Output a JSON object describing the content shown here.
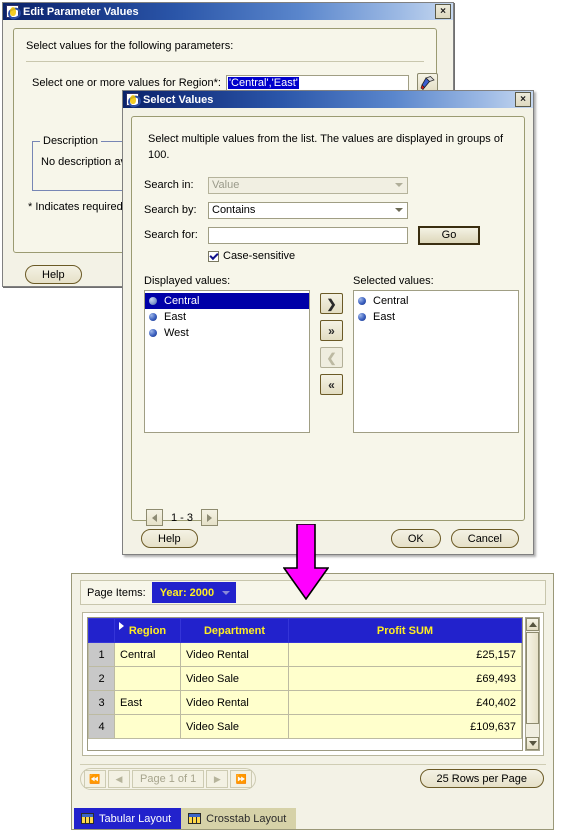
{
  "edit_params_window": {
    "title": "Edit Parameter Values",
    "close_label": "×",
    "prompt": "Select values for the following parameters:",
    "param_label": "Select one or more values for Region*:",
    "param_value": "'Central','East'",
    "description_legend": "Description",
    "description_text": "No description avail",
    "required_note": "* Indicates required f",
    "help_label": "Help"
  },
  "select_values_window": {
    "title": "Select Values",
    "close_label": "×",
    "intro": "Select multiple values from the list. The values are displayed in groups of 100.",
    "search_in_label": "Search in:",
    "search_in_value": "Value",
    "search_by_label": "Search by:",
    "search_by_value": "Contains",
    "search_for_label": "Search for:",
    "search_for_value": "",
    "search_for_placeholder": "",
    "go_label": "Go",
    "case_sensitive_label": "Case-sensitive",
    "case_sensitive_checked": true,
    "displayed_caption": "Displayed values:",
    "selected_caption": "Selected values:",
    "displayed_values": [
      {
        "label": "Central",
        "selected": true
      },
      {
        "label": "East",
        "selected": false
      },
      {
        "label": "West",
        "selected": false
      }
    ],
    "selected_values": [
      {
        "label": "Central"
      },
      {
        "label": "East"
      }
    ],
    "transfer_buttons": [
      {
        "name": "move-right-button",
        "glyph": "❯",
        "disabled": false
      },
      {
        "name": "move-all-right-button",
        "glyph": "»",
        "disabled": false
      },
      {
        "name": "move-left-button",
        "glyph": "❮",
        "disabled": true
      },
      {
        "name": "move-all-left-button",
        "glyph": "«",
        "disabled": false
      }
    ],
    "pager_text": "1 - 3",
    "help_label": "Help",
    "ok_label": "OK",
    "cancel_label": "Cancel"
  },
  "report": {
    "page_items_label": "Page Items:",
    "page_item_chip": "Year: 2000",
    "columns": [
      "",
      "Region",
      "Department",
      "Profit SUM"
    ],
    "rows": [
      {
        "num": "1",
        "region": "Central",
        "department": "Video Rental",
        "profit": "£25,157"
      },
      {
        "num": "2",
        "region": "",
        "department": "Video Sale",
        "profit": "£69,493"
      },
      {
        "num": "3",
        "region": "East",
        "department": "Video Rental",
        "profit": "£40,402"
      },
      {
        "num": "4",
        "region": "",
        "department": "Video Sale",
        "profit": "£109,637"
      }
    ],
    "page_text": "Page 1 of 1",
    "rows_per_page_label": "25 Rows per Page",
    "tabs": [
      {
        "label": "Tabular Layout",
        "active": true
      },
      {
        "label": "Crosstab Layout",
        "active": false
      }
    ]
  },
  "colors": {
    "titlebar_navy": "#0a246a",
    "accent_blue": "#2222cc",
    "header_text_yellow": "#ffee22",
    "cell_yellow": "#ffffcc",
    "annotation_magenta": "#ff00ff",
    "panel_cream": "#f7f6ea"
  }
}
